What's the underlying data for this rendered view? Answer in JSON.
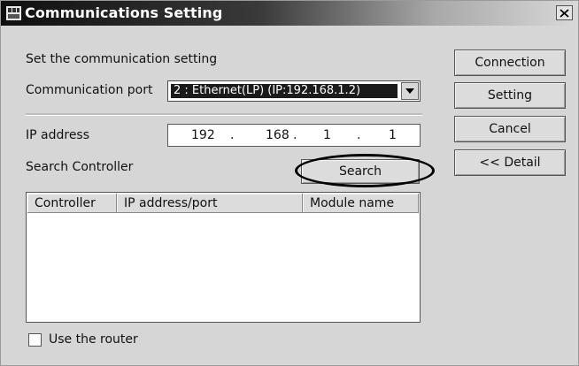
{
  "window": {
    "title": "Communications Setting",
    "close_glyph": "×"
  },
  "form": {
    "heading": "Set the communication setting",
    "comm_port_label": "Communication port",
    "comm_port_value": "2 : Ethernet(LP) (IP:192.168.1.2)",
    "ip_label": "IP address",
    "ip": [
      "192",
      "168",
      "1",
      "1"
    ],
    "ip_dot": ".",
    "search_label": "Search Controller",
    "search_button": "Search"
  },
  "list": {
    "columns": [
      "Controller",
      "IP address/port",
      "Module name"
    ],
    "rows": []
  },
  "router": {
    "label": "Use the router",
    "checked": false
  },
  "buttons": {
    "connection": "Connection",
    "setting": "Setting",
    "cancel": "Cancel",
    "detail": "<< Detail"
  },
  "icons": {
    "app": "app-icon",
    "close": "close-icon",
    "dropdown": "chevron-down-icon"
  }
}
